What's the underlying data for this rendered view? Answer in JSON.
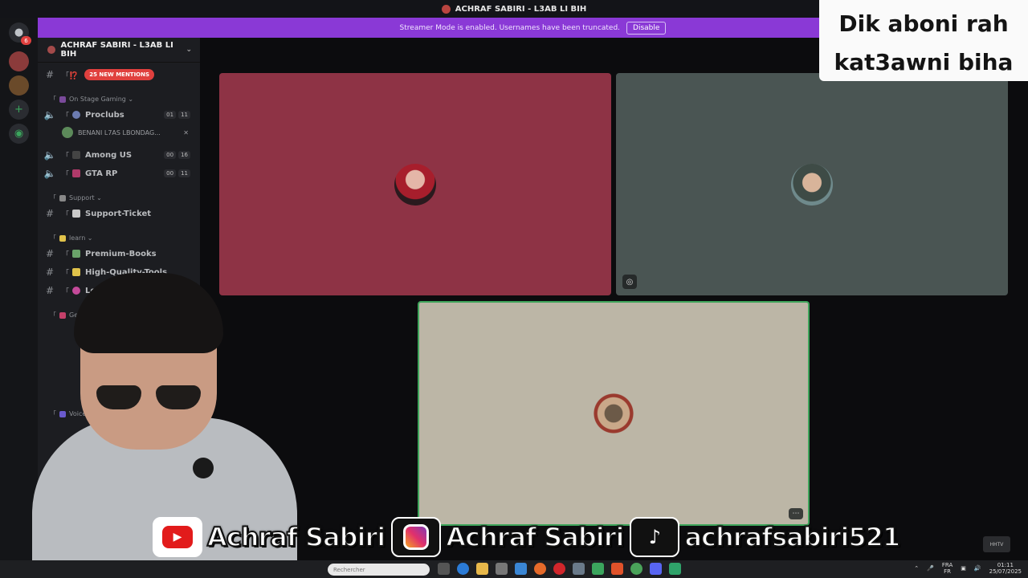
{
  "window": {
    "title": "ACHRAF SABIRI - L3AB LI BIH"
  },
  "banner": {
    "text": "Streamer Mode is enabled. Usernames have been truncated.",
    "disable_label": "Disable"
  },
  "caption": {
    "line1": "Dik aboni rah",
    "line2": "kat3awni biha"
  },
  "server": {
    "name": "ACHRAF SABIRI - L3AB LI BIH",
    "chevron": "chevron-down-icon"
  },
  "sidebar": {
    "mentions_badge": "25 NEW MENTIONS",
    "top_channel_prefix": "「⁉️",
    "categories": [
      {
        "label": "On Stage Gaming",
        "icon": "joystick-icon"
      },
      {
        "label": "Support",
        "icon": "tools-icon"
      },
      {
        "label": "learn",
        "icon": "bulb-icon"
      },
      {
        "label": "Get Vo",
        "icon": "sparkle-icon"
      },
      {
        "label": "Voices",
        "icon": "speaker-icon"
      }
    ],
    "channels": [
      {
        "type": "voice",
        "name": "Proclubs",
        "count_a": "01",
        "count_b": "11"
      },
      {
        "type": "voice",
        "name": "Among US",
        "count_a": "00",
        "count_b": "16"
      },
      {
        "type": "voice",
        "name": "GTA RP",
        "count_a": "00",
        "count_b": "11"
      },
      {
        "type": "text",
        "name": "Support-Ticket"
      },
      {
        "type": "text",
        "name": "Premium-Books"
      },
      {
        "type": "text",
        "name": "High-Quality-Tools"
      },
      {
        "type": "text",
        "name": "Learn"
      }
    ],
    "member": {
      "name": "BENANI L7AS LBONDAG..."
    }
  },
  "social": {
    "youtube": "Achraf Sabiri",
    "instagram": "Achraf Sabiri",
    "tiktok": "achrafsabiri521"
  },
  "taskbar": {
    "search_placeholder": "Rechercher",
    "lang_top": "FRA",
    "lang_bottom": "FR",
    "time": "01:11",
    "date": "25/07/2025"
  },
  "watermark": "HHTV",
  "colors": {
    "banner": "#8a39d6",
    "mentions": "#e0403e",
    "speaking": "#3ea55b"
  }
}
